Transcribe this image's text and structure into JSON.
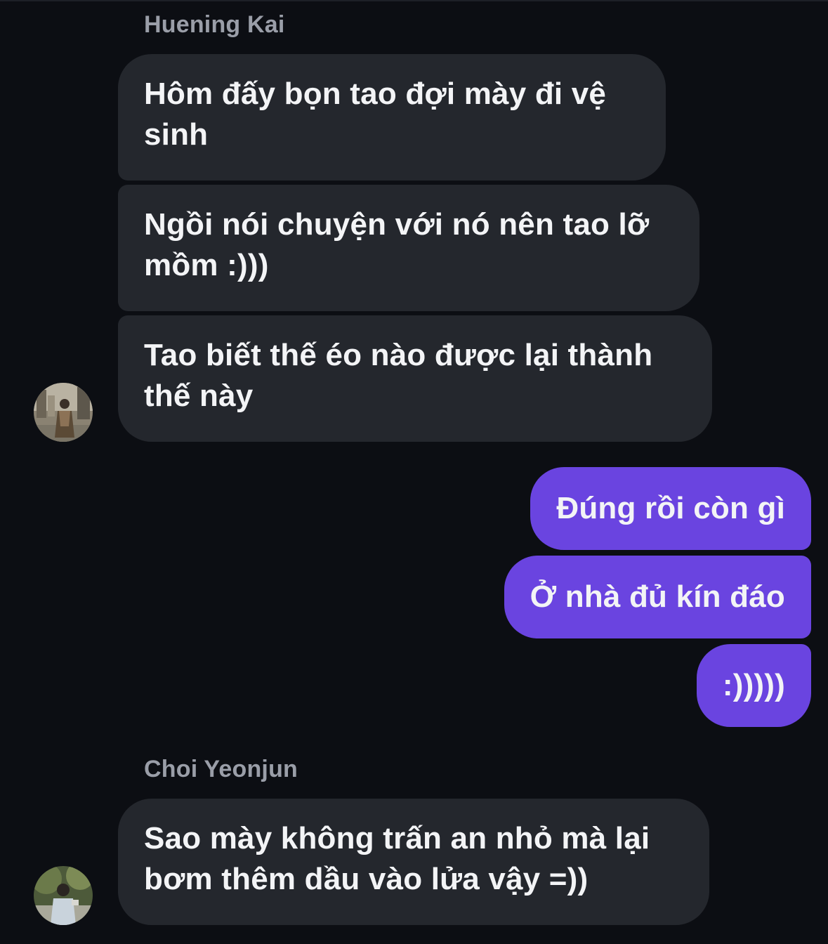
{
  "conversation": {
    "groups": [
      {
        "sender": "Huening Kai",
        "messages": [
          "Hôm đấy bọn tao đợi mày đi vệ sinh",
          "Ngồi nói chuyện với nó nên tao lỡ mồm :)))",
          "Tao biết thế éo nào được lại thành thế này"
        ],
        "avatar_icon": "avatar-photo-icon"
      },
      {
        "sender": "me",
        "messages": [
          "Đúng rồi còn gì",
          "Ở nhà đủ kín đáo",
          ":)))))"
        ]
      },
      {
        "sender": "Choi Yeonjun",
        "messages": [
          "Sao mày không trấn an nhỏ mà lại bơm thêm dầu vào lửa vậy =))"
        ],
        "avatar_icon": "avatar-photo-icon"
      }
    ]
  },
  "colors": {
    "background": "#0c0e13",
    "incoming_bubble": "#24272d",
    "outgoing_bubble": "#6a44e0",
    "sender_name": "#9a9ea8",
    "text": "#f3f4f6"
  }
}
